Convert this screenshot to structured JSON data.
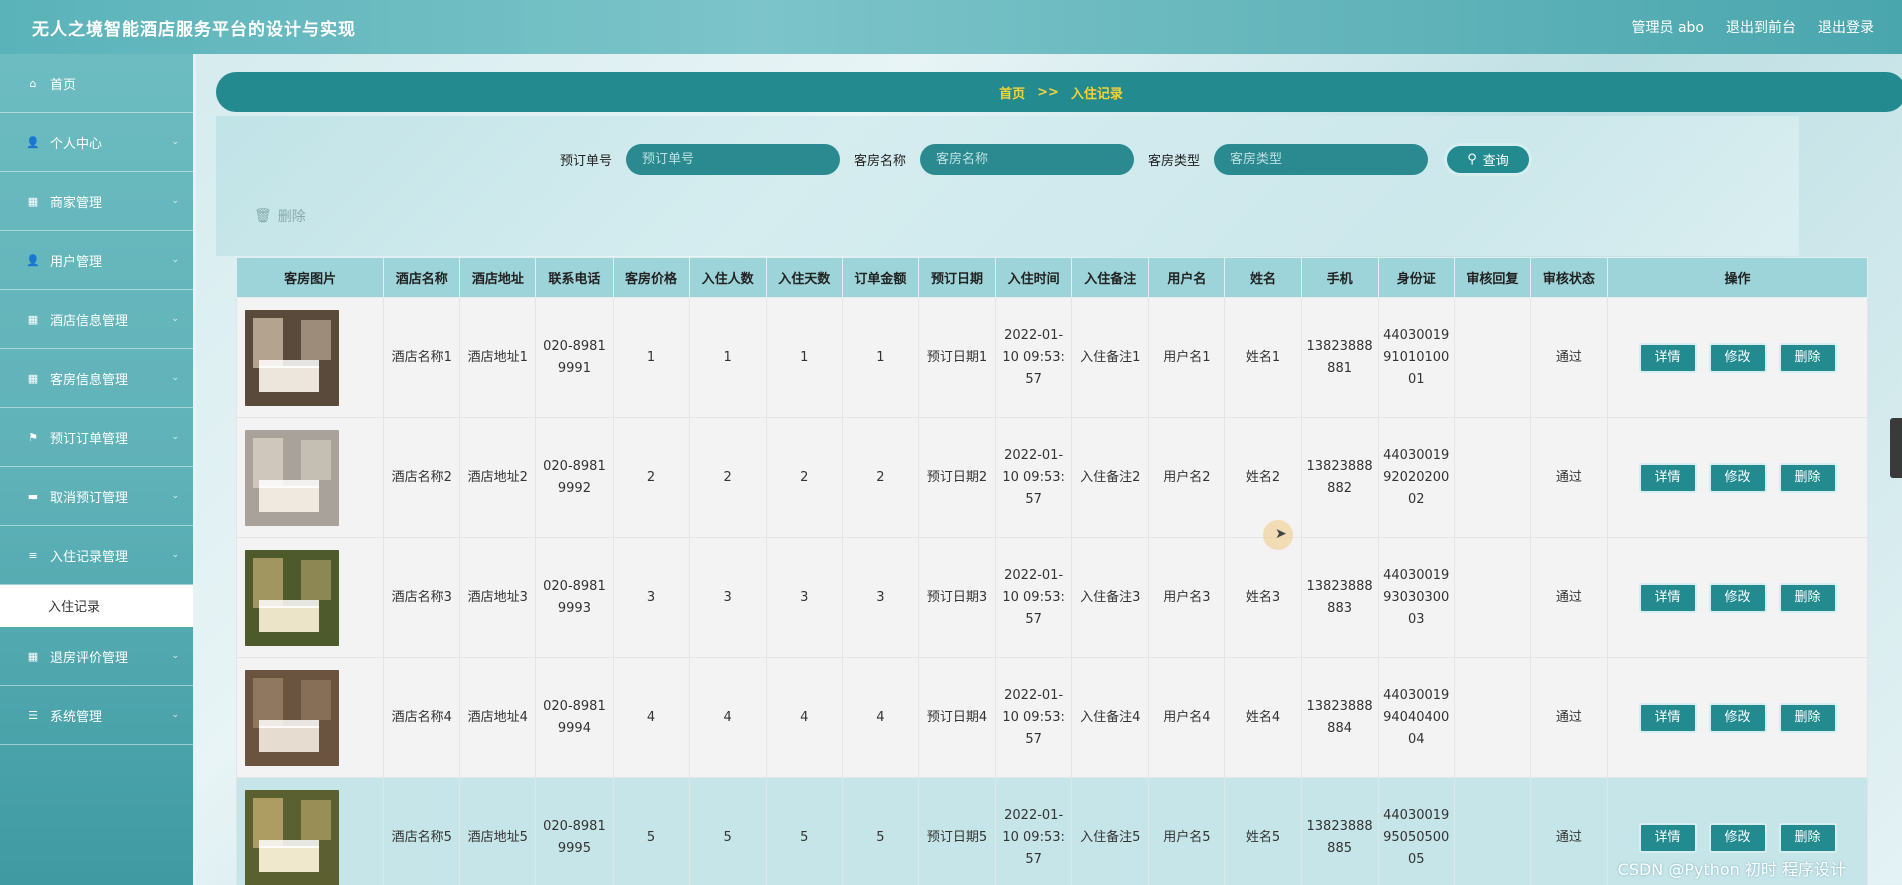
{
  "header": {
    "title": "无人之境智能酒店服务平台的设计与实现",
    "links": [
      "管理员 abo",
      "退出到前台",
      "退出登录"
    ]
  },
  "sidebar": {
    "items": [
      {
        "label": "首页",
        "icon": "home-icon"
      },
      {
        "label": "个人中心",
        "icon": "user-icon"
      },
      {
        "label": "商家管理",
        "icon": "grid-icon"
      },
      {
        "label": "用户管理",
        "icon": "user-icon"
      },
      {
        "label": "酒店信息管理",
        "icon": "grid-icon"
      },
      {
        "label": "客房信息管理",
        "icon": "grid-icon"
      },
      {
        "label": "预订订单管理",
        "icon": "flag-icon"
      },
      {
        "label": "取消预订管理",
        "icon": "message-icon"
      },
      {
        "label": "入住记录管理",
        "icon": "list-icon"
      },
      {
        "label": "退房评价管理",
        "icon": "grid-icon"
      },
      {
        "label": "系统管理",
        "icon": "sliders-icon"
      }
    ],
    "submenu_label": "入住记录"
  },
  "breadcrumb": {
    "home": "首页",
    "sep": ">>",
    "current": "入住记录"
  },
  "search": {
    "order_label": "预订单号",
    "order_placeholder": "预订单号",
    "room_label": "客房名称",
    "room_placeholder": "客房名称",
    "type_label": "客房类型",
    "type_placeholder": "客房类型",
    "button_label": "查询"
  },
  "delete_label": "删除",
  "table": {
    "headers": [
      "客房图片",
      "酒店名称",
      "酒店地址",
      "联系电话",
      "客房价格",
      "入住人数",
      "入住天数",
      "订单金额",
      "预订日期",
      "入住时间",
      "入住备注",
      "用户名",
      "姓名",
      "手机",
      "身份证",
      "审核回复",
      "审核状态",
      "操作"
    ],
    "ops": [
      "详情",
      "修改",
      "删除"
    ],
    "rows": [
      [
        "酒店名称1",
        "酒店地址1",
        "020-89819991",
        "1",
        "1",
        "1",
        "1",
        "预订日期1",
        "2022-01-10 09:53:57",
        "入住备注1",
        "用户名1",
        "姓名1",
        "13823888881",
        "440300199101010001",
        "",
        "通过"
      ],
      [
        "酒店名称2",
        "酒店地址2",
        "020-89819992",
        "2",
        "2",
        "2",
        "2",
        "预订日期2",
        "2022-01-10 09:53:57",
        "入住备注2",
        "用户名2",
        "姓名2",
        "13823888882",
        "440300199202020002",
        "",
        "通过"
      ],
      [
        "酒店名称3",
        "酒店地址3",
        "020-89819993",
        "3",
        "3",
        "3",
        "3",
        "预订日期3",
        "2022-01-10 09:53:57",
        "入住备注3",
        "用户名3",
        "姓名3",
        "13823888883",
        "440300199303030003",
        "",
        "通过"
      ],
      [
        "酒店名称4",
        "酒店地址4",
        "020-89819994",
        "4",
        "4",
        "4",
        "4",
        "预订日期4",
        "2022-01-10 09:53:57",
        "入住备注4",
        "用户名4",
        "姓名4",
        "13823888884",
        "440300199404040004",
        "",
        "通过"
      ],
      [
        "酒店名称5",
        "酒店地址5",
        "020-89819995",
        "5",
        "5",
        "5",
        "5",
        "预订日期5",
        "2022-01-10 09:53:57",
        "入住备注5",
        "用户名5",
        "姓名5",
        "13823888885",
        "440300199505050005",
        "",
        "通过"
      ]
    ]
  },
  "watermark": "CSDN @Python 初时 程序设计",
  "colors": {
    "primary": "#238a8f",
    "breadcrumb_text": "#f4d335",
    "sidebar": "#5fb2b8"
  }
}
